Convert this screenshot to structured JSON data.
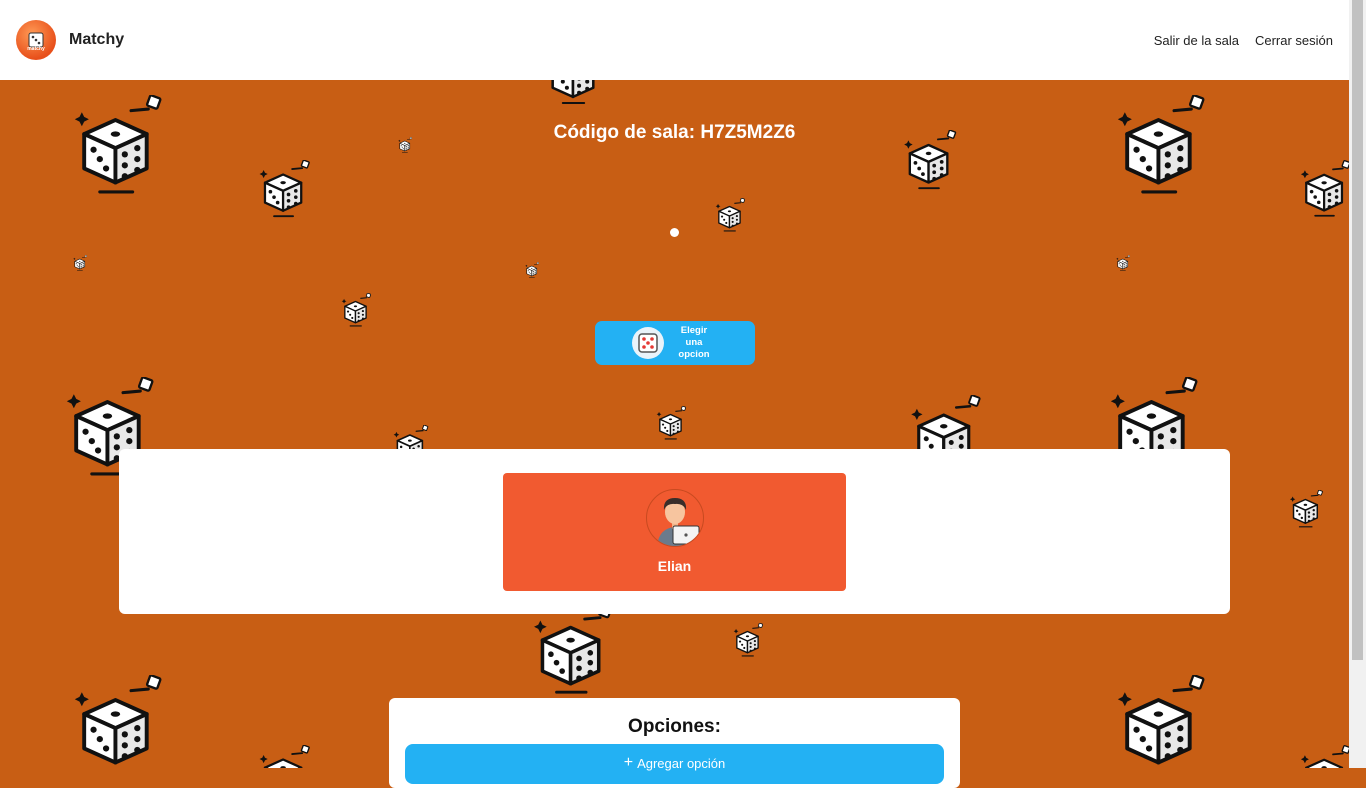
{
  "header": {
    "brand": "Matchy",
    "logo_text": "matchy",
    "nav": {
      "leave_room": "Salir de la sala",
      "logout": "Cerrar sesión"
    }
  },
  "room": {
    "code_label": "Código de sala: H7Z5M2Z6"
  },
  "choose_button": {
    "label": "Elegir una opcion",
    "icon": "dice-icon"
  },
  "players": [
    {
      "name": "Elian",
      "avatar": "person-laptop-avatar"
    }
  ],
  "options": {
    "title": "Opciones:",
    "add_button": "Agregar opción"
  },
  "colors": {
    "background": "#c85e14",
    "accent_blue": "#23b1f3",
    "player_card": "#f15a30"
  }
}
